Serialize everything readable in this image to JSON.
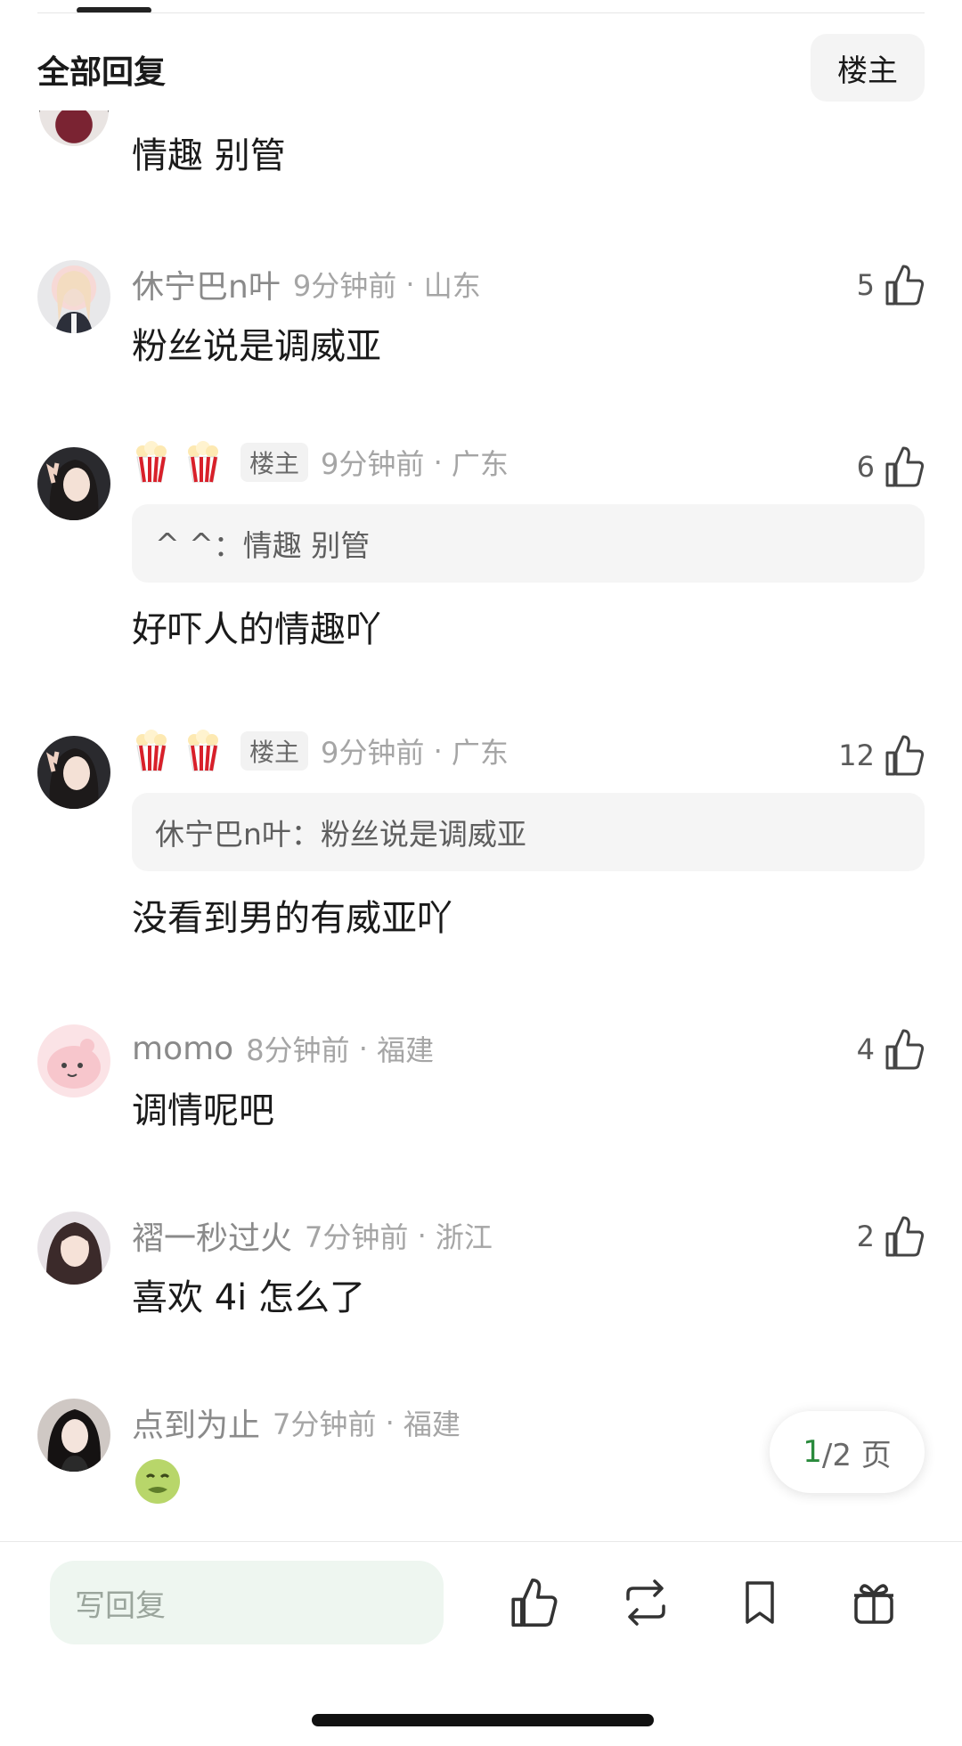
{
  "header": {
    "title": "全部回复",
    "op_filter_label": "楼主"
  },
  "partial_comment": {
    "text": "情趣 别管"
  },
  "comments": [
    {
      "user": "休宁巴n叶",
      "time": "9分钟前",
      "location": "山东",
      "likes": "5",
      "text": "粉丝说是调威亚"
    },
    {
      "user": "",
      "badge": "楼主",
      "time": "9分钟前",
      "location": "广东",
      "likes": "6",
      "quote_user": "^ ^",
      "quote_text": "情趣 别管",
      "text": "好吓人的情趣吖"
    },
    {
      "user": "",
      "badge": "楼主",
      "time": "9分钟前",
      "location": "广东",
      "likes": "12",
      "quote_user": "休宁巴n叶",
      "quote_text": "粉丝说是调威亚",
      "text": "没看到男的有威亚吖"
    },
    {
      "user": "momo",
      "time": "8分钟前",
      "location": "福建",
      "likes": "4",
      "text": "调情呢吧"
    },
    {
      "user": "褶一秒过火",
      "time": "7分钟前",
      "location": "浙江",
      "likes": "2",
      "text": "喜欢 4i 怎么了"
    },
    {
      "user": "点到为止",
      "time": "7分钟前",
      "location": "福建",
      "likes": "",
      "text": ""
    }
  ],
  "pager": {
    "current": "1",
    "rest": "/2 页"
  },
  "bottom_bar": {
    "reply_placeholder": "写回复",
    "icons": [
      "thumbs-up-icon",
      "repost-icon",
      "bookmark-icon",
      "gift-icon"
    ]
  },
  "colors": {
    "accent_green": "#2a8a3c",
    "input_bg": "#eef6f0",
    "meta_gray": "#a5a5a5"
  }
}
